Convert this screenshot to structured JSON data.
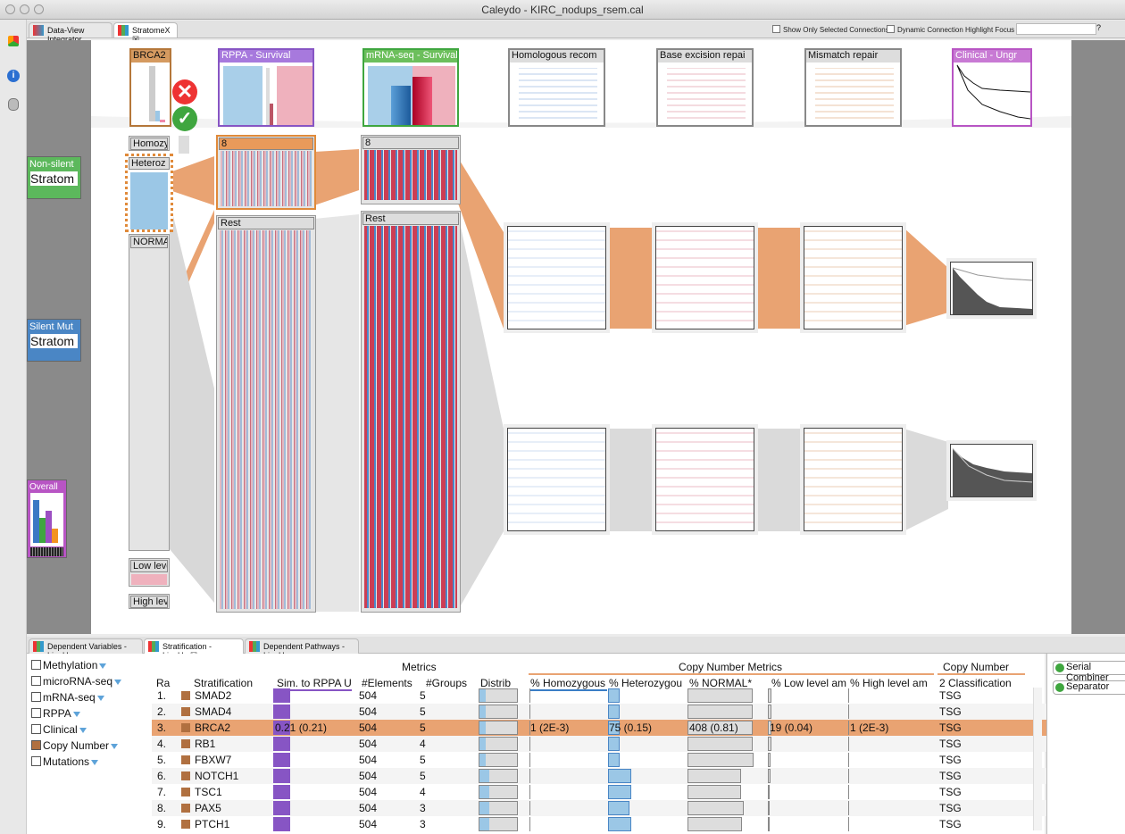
{
  "window": {
    "title": "Caleydo - KIRC_nodups_rsem.cal"
  },
  "tabs": [
    {
      "label": "Data-View Integrator"
    },
    {
      "label": "StratomeX ☒"
    }
  ],
  "options": {
    "show_selected": "Show Only Selected Connections",
    "dynamic_highlight": "Dynamic Connection Highlight Focus"
  },
  "left_stratifications": [
    {
      "title": "Non-silent",
      "sub": "Stratom",
      "color": "#5cb85c"
    },
    {
      "title": "Silent Mut",
      "sub": "Stratom",
      "color": "#4a86c5"
    },
    {
      "title": "Overall",
      "color": "#b855c4"
    }
  ],
  "columns": [
    {
      "label": "BRCA2",
      "color": "#b5773a"
    },
    {
      "label": "RPPA - Survival",
      "color": "#8755c4"
    },
    {
      "label": "mRNA-seq - Survival",
      "color": "#3fa63f"
    },
    {
      "label": "Homologous recom",
      "color": "#888"
    },
    {
      "label": "Base excision repai",
      "color": "#888"
    },
    {
      "label": "Mismatch repair",
      "color": "#888"
    },
    {
      "label": "Clinical - Ungr",
      "color": "#b855c4"
    }
  ],
  "brca_groups": [
    "Homozy",
    "Heteroz",
    "NORMA",
    "Low leve",
    "High lev"
  ],
  "rppa_groups": [
    "8",
    "Rest"
  ],
  "mrna_groups": [
    "8",
    "Rest"
  ],
  "bottom_tabs": [
    {
      "label": "Dependent Variables - LineUp"
    },
    {
      "label": "Stratification - LineUp ☒"
    },
    {
      "label": "Dependent Pathways - LineUp"
    }
  ],
  "categories": [
    {
      "label": "Methylation",
      "checked": false
    },
    {
      "label": "microRNA-seq",
      "checked": false
    },
    {
      "label": "mRNA-seq",
      "checked": false
    },
    {
      "label": "RPPA",
      "checked": false
    },
    {
      "label": "Clinical",
      "checked": false
    },
    {
      "label": "Copy Number",
      "checked": true
    },
    {
      "label": "Mutations",
      "checked": false
    }
  ],
  "table": {
    "group_headers": {
      "metrics": "Metrics",
      "cn_metrics": "Copy Number Metrics",
      "cn": "Copy Number"
    },
    "headers": {
      "rank": "Ra",
      "strat": "Stratification",
      "sim": "Sim. to RPPA U",
      "elements": "#Elements",
      "groups": "#Groups",
      "distrib": "Distrib",
      "homo": "% Homozygous",
      "hetero": "% Heterozygou",
      "normal": "% NORMAL*",
      "low": "% Low level am",
      "high": "% High level am",
      "classification": "2 Classification"
    },
    "rows": [
      {
        "rank": "1.",
        "name": "SMAD2",
        "sim": 0.21,
        "elements": "504",
        "groups": "5",
        "distrib": 0.15,
        "homo": 0,
        "hetero": 0.15,
        "normal": 0.81,
        "low": 0.04,
        "high": 0,
        "cls": "TSG"
      },
      {
        "rank": "2.",
        "name": "SMAD4",
        "sim": 0.21,
        "elements": "504",
        "groups": "5",
        "distrib": 0.15,
        "homo": 0,
        "hetero": 0.15,
        "normal": 0.81,
        "low": 0.04,
        "high": 0,
        "cls": "TSG"
      },
      {
        "rank": "3.",
        "name": "BRCA2",
        "sim": 0.21,
        "sim_text": "0.21 (0.21)",
        "elements": "504",
        "groups": "5",
        "distrib": 0.15,
        "homo": 0,
        "hetero": 0.15,
        "normal": 0.81,
        "low": 0.04,
        "high": 0,
        "cls": "TSG",
        "homo_text": "1 (2E-3)",
        "hetero_text": "75 (0.15)",
        "normal_text": "408 (0.81)",
        "low_text": "19 (0.04)",
        "high_text": "1 (2E-3)",
        "selected": true
      },
      {
        "rank": "4.",
        "name": "RB1",
        "sim": 0.21,
        "elements": "504",
        "groups": "4",
        "distrib": 0.15,
        "homo": 0,
        "hetero": 0.15,
        "normal": 0.81,
        "low": 0.04,
        "high": 0,
        "cls": "TSG"
      },
      {
        "rank": "5.",
        "name": "FBXW7",
        "sim": 0.21,
        "elements": "504",
        "groups": "5",
        "distrib": 0.15,
        "homo": 0,
        "hetero": 0.15,
        "normal": 0.82,
        "low": 0.03,
        "high": 0,
        "cls": "TSG"
      },
      {
        "rank": "6.",
        "name": "NOTCH1",
        "sim": 0.21,
        "elements": "504",
        "groups": "5",
        "distrib": 0.25,
        "homo": 0,
        "hetero": 0.3,
        "normal": 0.67,
        "low": 0.03,
        "high": 0,
        "cls": "TSG"
      },
      {
        "rank": "7.",
        "name": "TSC1",
        "sim": 0.21,
        "elements": "504",
        "groups": "4",
        "distrib": 0.25,
        "homo": 0,
        "hetero": 0.3,
        "normal": 0.67,
        "low": 0.02,
        "high": 0,
        "cls": "TSG"
      },
      {
        "rank": "8.",
        "name": "PAX5",
        "sim": 0.21,
        "elements": "504",
        "groups": "3",
        "distrib": 0.25,
        "homo": 0,
        "hetero": 0.28,
        "normal": 0.7,
        "low": 0.02,
        "high": 0,
        "cls": "TSG"
      },
      {
        "rank": "9.",
        "name": "PTCH1",
        "sim": 0.21,
        "elements": "504",
        "groups": "3",
        "distrib": 0.25,
        "homo": 0,
        "hetero": 0.3,
        "normal": 0.68,
        "low": 0.02,
        "high": 0,
        "cls": "TSG"
      }
    ]
  },
  "right_panel": {
    "items": [
      "Serial Combiner",
      "Separator"
    ]
  }
}
